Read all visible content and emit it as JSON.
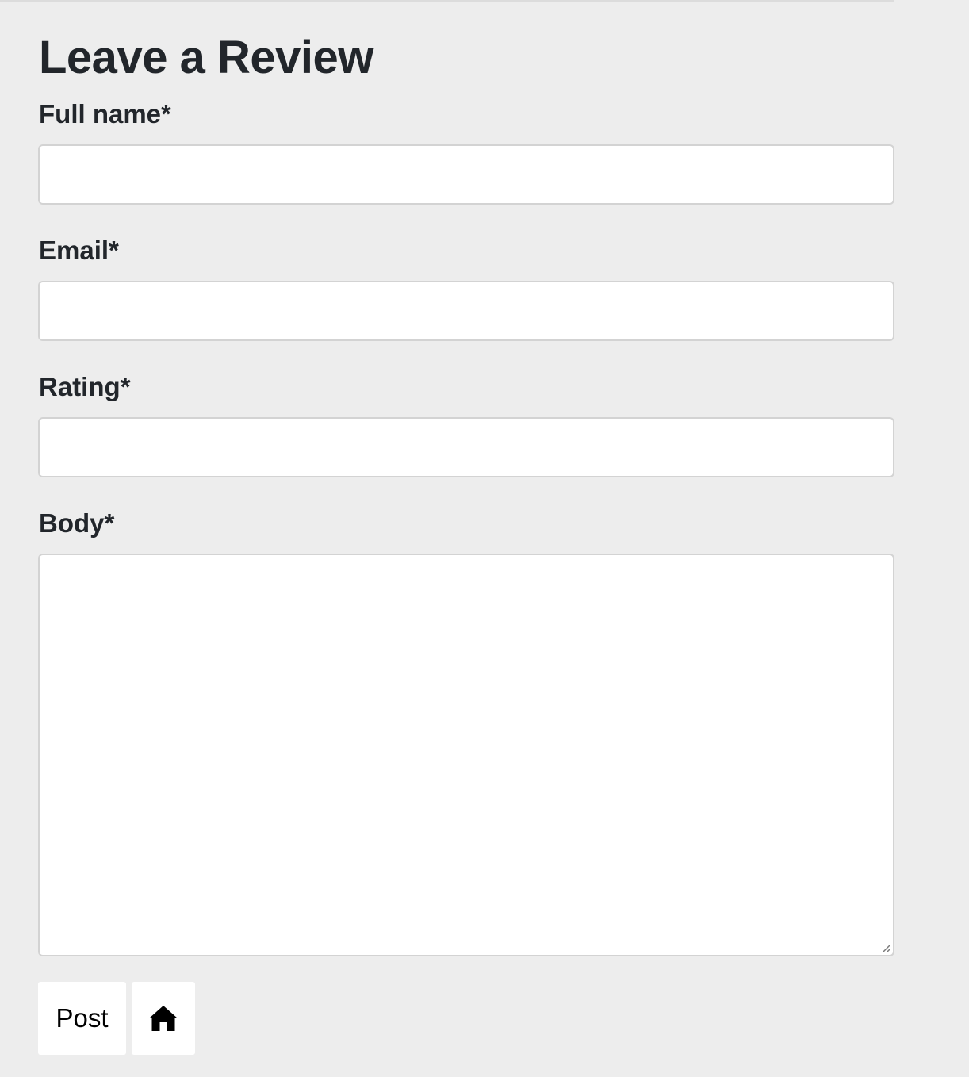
{
  "form": {
    "title": "Leave a Review",
    "fields": [
      {
        "label": "Full name*",
        "value": "",
        "placeholder": ""
      },
      {
        "label": "Email*",
        "value": "",
        "placeholder": ""
      },
      {
        "label": "Rating*",
        "value": "",
        "placeholder": ""
      },
      {
        "label": "Body*",
        "value": "",
        "placeholder": ""
      }
    ],
    "post_label": "Post",
    "home_icon": "home-icon"
  },
  "colors": {
    "background": "#ededed",
    "field_background": "#ffffff",
    "field_border": "#d3d3d3",
    "text": "#22262b"
  }
}
